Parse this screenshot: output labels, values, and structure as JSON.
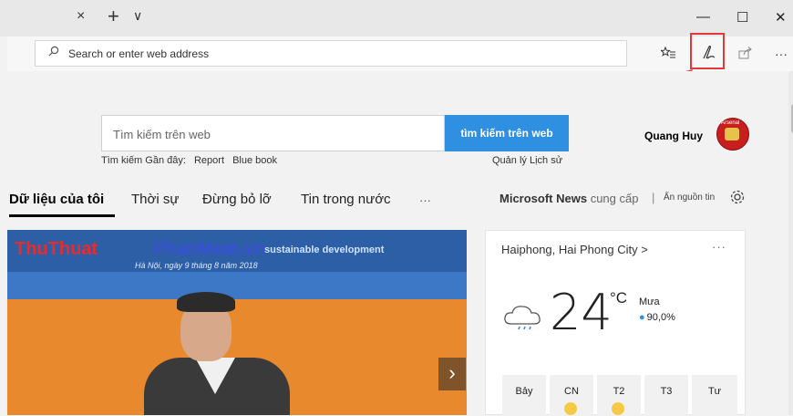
{
  "tabbar": {
    "close_glyph": "×",
    "new_tab_glyph": "+",
    "tab_list_glyph": "∨",
    "minimize_glyph": "—",
    "maximize_glyph": "☐",
    "window_close_glyph": "✕"
  },
  "toolbar": {
    "address_placeholder": "Search or enter web address",
    "icons": [
      "search-icon",
      "favorites-list-icon",
      "make-web-note-icon",
      "share-icon",
      "more-icon"
    ],
    "more_glyph": "···"
  },
  "search": {
    "placeholder": "Tìm kiếm trên web",
    "button_label": "tìm kiếm trên web",
    "recent_prefix": "Tìm kiếm Gần đây:",
    "recent_items": [
      "Report",
      "Blue book"
    ],
    "manage_history": "Quản lý Lịch sử"
  },
  "user": {
    "name": "Quang Huy",
    "avatar_text": "Arsenal"
  },
  "nav": {
    "items": [
      "Dữ liệu của tôi",
      "Thời sự",
      "Đừng bỏ lỡ",
      "Tin trong nước"
    ],
    "more": "···",
    "provider_brand": "Microsoft News",
    "provider_suffix": "cung cấp",
    "separator": "|",
    "hide_sources": "Ẩn nguồn tin"
  },
  "hero": {
    "watermark_part1": "ThuThuat",
    "watermark_part2": "PhanMem.vn",
    "banner_text": "sustainable development",
    "banner_date": "Hà Nội, ngày 9 tháng 8 năm 2018"
  },
  "weather": {
    "location": "Haiphong, Hai Phong City",
    "location_chevron": ">",
    "more": "···",
    "temperature": "24",
    "unit": "°C",
    "condition": "Mưa",
    "humidity": "90,0%",
    "days": [
      "Bảy",
      "CN",
      "T2",
      "T3",
      "Tư"
    ]
  },
  "colors": {
    "accent_blue": "#2f8fe0",
    "highlight_red": "#e03a3a"
  }
}
